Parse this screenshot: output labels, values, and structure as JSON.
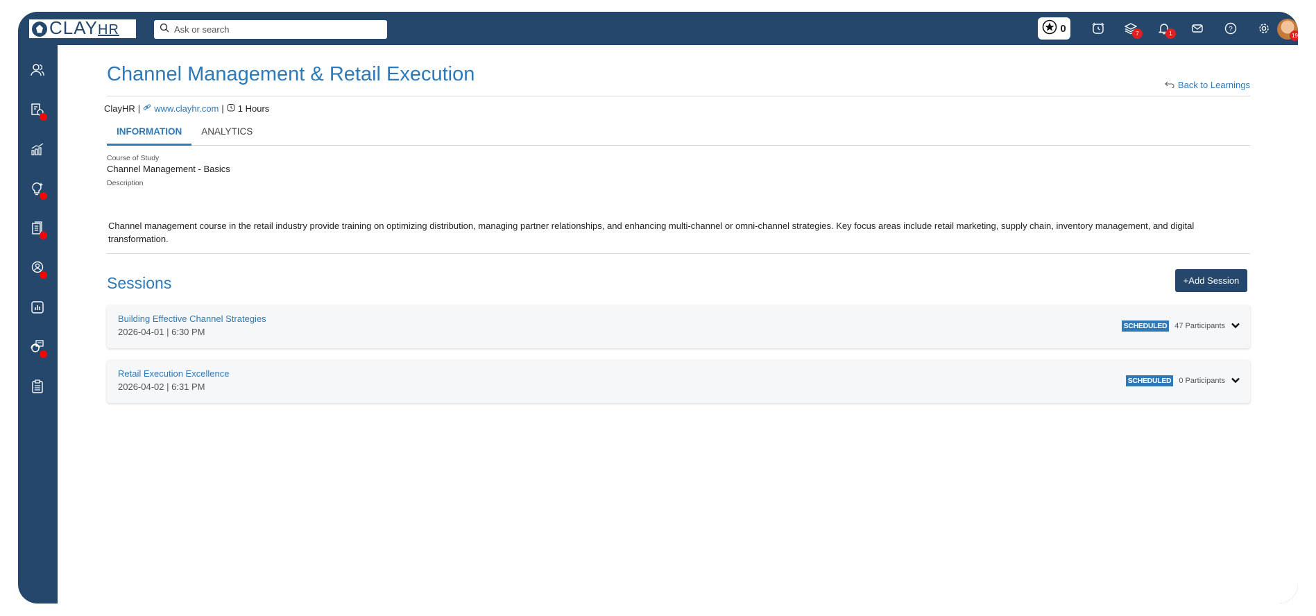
{
  "app": {
    "logo_text": "CLAY",
    "logo_suffix": "HR",
    "search_placeholder": "Ask or search",
    "points": "0",
    "badges": {
      "learning": "7",
      "notifications": "1",
      "avatar": "19"
    },
    "colors": {
      "header": "#24476b",
      "accent": "#2e79b8",
      "badge": "#e02020",
      "sidebar_dot": "#ff0000"
    }
  },
  "sidebar": {
    "items": [
      {
        "icon": "people-icon",
        "dot": false
      },
      {
        "icon": "timesheet-icon",
        "dot": true
      },
      {
        "icon": "analytics-icon",
        "dot": false
      },
      {
        "icon": "lightbulb-icon",
        "dot": true
      },
      {
        "icon": "documents-icon",
        "dot": true
      },
      {
        "icon": "user-circle-icon",
        "dot": true
      },
      {
        "icon": "report-chart-icon",
        "dot": false
      },
      {
        "icon": "helpdesk-icon",
        "dot": true
      },
      {
        "icon": "clipboard-icon",
        "dot": false
      }
    ]
  },
  "page": {
    "title": "Channel Management & Retail Execution",
    "back_link": "Back to Learnings",
    "provider": "ClayHR",
    "separator": "|",
    "website": "www.clayhr.com",
    "duration": "1 Hours",
    "tabs": [
      {
        "label": "INFORMATION",
        "active": true
      },
      {
        "label": "ANALYTICS",
        "active": false
      }
    ],
    "course_label": "Course of Study",
    "course_value": "Channel Management - Basics",
    "description_label": "Description",
    "description": "Channel management course in the retail industry provide training on optimizing distribution, managing partner relationships, and enhancing multi-channel or omni-channel strategies. Key focus areas include retail marketing, supply chain, inventory management, and digital transformation."
  },
  "sessions": {
    "title": "Sessions",
    "add_button": "+Add Session",
    "items": [
      {
        "name": "Building Effective Channel Strategies",
        "datetime": "2026-04-01 | 6:30 PM",
        "status": "SCHEDULED",
        "participants": "47 Participants"
      },
      {
        "name": "Retail Execution Excellence",
        "datetime": "2026-04-02 | 6:31 PM",
        "status": "SCHEDULED",
        "participants": "0 Participants"
      }
    ]
  }
}
